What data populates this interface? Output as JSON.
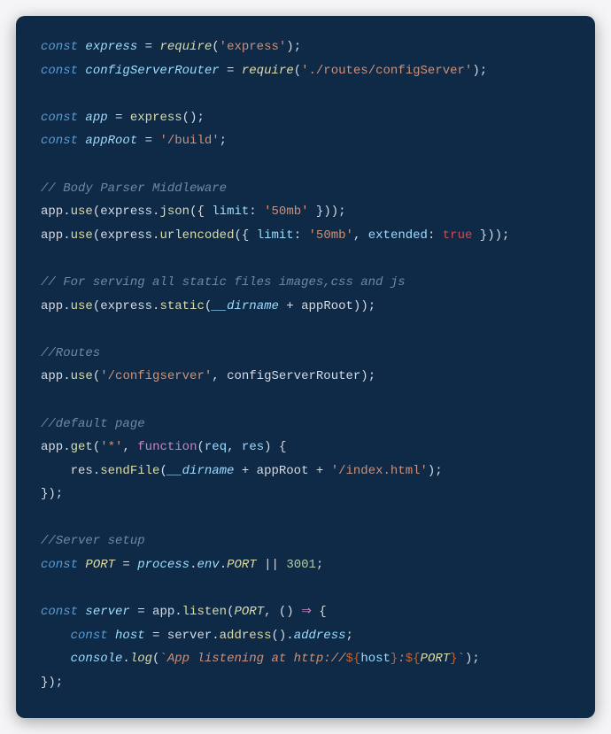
{
  "code": {
    "l1": {
      "kw": "const",
      "v": "express",
      "eq": " = ",
      "req": "require",
      "lp": "(",
      "s": "'express'",
      "rp": ")",
      ";": ";"
    },
    "l2": {
      "kw": "const",
      "v": "configServerRouter",
      "eq": " = ",
      "req": "require",
      "lp": "(",
      "s": "'./routes/configServer'",
      "rp": ")",
      ";": ";"
    },
    "l3": "",
    "l4": {
      "kw": "const",
      "v": "app",
      "eq": " = ",
      "fn": "express",
      "lp": "()",
      ";": ";"
    },
    "l5": {
      "kw": "const",
      "v": "appRoot",
      "eq": " = ",
      "s": "'/build'",
      ";": ";"
    },
    "l6": "",
    "l7": {
      "com": "// Body Parser Middleware"
    },
    "l8": {
      "t1": "app.",
      "fn1": "use",
      "t2": "(express.",
      "fn2": "json",
      "t3": "({ ",
      "prop": "limit",
      "t4": ": ",
      "s": "'50mb'",
      "t5": " }));"
    },
    "l9": {
      "t1": "app.",
      "fn1": "use",
      "t2": "(express.",
      "fn2": "urlencoded",
      "t3": "({ ",
      "prop1": "limit",
      "t4": ": ",
      "s": "'50mb'",
      "t5": ", ",
      "prop2": "extended",
      "t6": ": ",
      "bool": "true",
      "t7": " }));"
    },
    "l10": "",
    "l11": {
      "com": "// For serving all static files images,css and js"
    },
    "l12": {
      "t1": "app.",
      "fn1": "use",
      "t2": "(express.",
      "fn2": "static",
      "t3": "(",
      "v": "__dirname",
      "t4": " + appRoot));"
    },
    "l13": "",
    "l14": {
      "com": "//Routes"
    },
    "l15": {
      "t1": "app.",
      "fn": "use",
      "t2": "(",
      "s": "'/configserver'",
      "t3": ", configServerRouter);"
    },
    "l16": "",
    "l17": {
      "com": "//default page"
    },
    "l18": {
      "t1": "app.",
      "fn": "get",
      "t2": "(",
      "s": "'*'",
      "t3": ", ",
      "fnkw": "function",
      "t4": "(",
      "p1": "req",
      "t5": ", ",
      "p2": "res",
      "t6": ") {"
    },
    "l19": {
      "indent": "    ",
      "t1": "res.",
      "fn": "sendFile",
      "t2": "(",
      "v": "__dirname",
      "t3": " + appRoot + ",
      "s": "'/index.html'",
      "t4": ");"
    },
    "l20": {
      "t": "});"
    },
    "l21": "",
    "l22": {
      "com": "//Server setup"
    },
    "l23": {
      "kw": "const",
      "id": "PORT",
      "eq": " = ",
      "v1": "process",
      "d1": ".",
      "v2": "env",
      "d2": ".",
      "v3": "PORT",
      "or": " || ",
      "num": "3001",
      ";": ";"
    },
    "l24": "",
    "l25": {
      "kw": "const",
      "v": "server",
      "eq": " = app.",
      "fn": "listen",
      "lp": "(",
      "id": "PORT",
      "c": ", () ",
      "arrow": "⇒",
      "t": " {"
    },
    "l26": {
      "indent": "    ",
      "kw": "const",
      "v": "host",
      "eq": " = server.",
      "fn": "address",
      "t1": "().",
      "prop": "address",
      ";": ";"
    },
    "l27": {
      "indent": "    ",
      "obj": "console",
      "d": ".",
      "fn": "log",
      "lp": "(",
      "bt": "`",
      "tpl1": "App listening at http://",
      "i1o": "${",
      "i1v": "host",
      "i1c": "}",
      "tpl2": ":",
      "i2o": "${",
      "i2v": "PORT",
      "i2c": "}",
      "bt2": "`",
      "rp": ");"
    },
    "l28": {
      "t": "});"
    }
  }
}
